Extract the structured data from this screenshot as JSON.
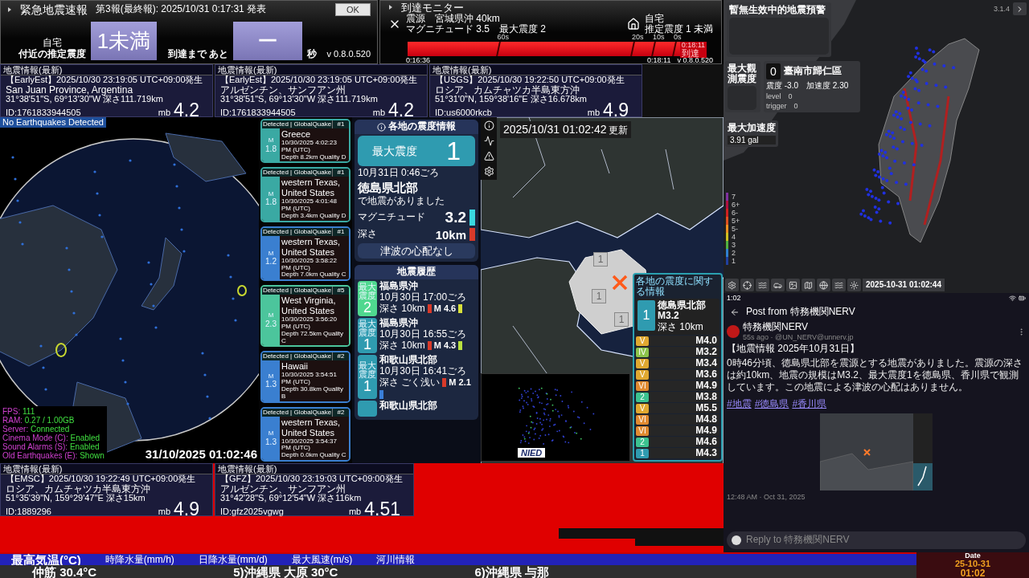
{
  "eew": {
    "title": "緊急地震速報",
    "report": "第3報(最終報): 2025/10/31 0:17:31 発表",
    "ok": "OK",
    "location_label": "自宅",
    "intensity_label": "付近の推定震度",
    "intensity": "1未満",
    "until_label": "到達まで あと",
    "seconds": "ー",
    "seconds_unit": "秒",
    "version": "v 0.8.0.520"
  },
  "arrival": {
    "title": "到達モニター",
    "epicenter": "震源　宮城県沖 40km",
    "magnitude": "マグニチュード 3.5　最大震度 2",
    "home": "自宅",
    "home_intensity": "推定震度 1 未満",
    "ticks": [
      "60s",
      "20s",
      "10s",
      "0s"
    ],
    "arrival_time": "0:18:11",
    "arrival_label": "到達",
    "start": "0:16:36",
    "end": "0:18:11",
    "version": "v 0.8.0.520"
  },
  "top_cards": [
    {
      "header": "地震情報(最新)",
      "source": "【EarlyEst】2025/10/30  23:19:05  UTC+09:00発生",
      "place": "San Juan Province, Argentina",
      "coords": "31°38'51\"S, 69°13'30\"W  深さ111.719km",
      "id": "ID:1761833944505",
      "mag_type": "mb",
      "mag": "4.2"
    },
    {
      "header": "地震情報(最新)",
      "source": "【EarlyEst】2025/10/30  23:19:05  UTC+09:00発生",
      "place": "アルゼンチン、サンフアン州",
      "coords": "31°38'51\"S, 69°13'30\"W  深さ111.719km",
      "id": "ID:1761833944505",
      "mag_type": "mb",
      "mag": "4.2"
    },
    {
      "header": "地震情報(最新)",
      "source": "【USGS】2025/10/30  19:22:50  UTC+09:00発生",
      "place": "ロシア、カムチャツカ半島東方沖",
      "coords": "51°31'0\"N, 159°38'16\"E  深さ16.678km",
      "id": "ID:us6000rkcb",
      "mag_type": "mb",
      "mag": "4.9"
    }
  ],
  "globe": {
    "banner": "No Earthquakes Detected",
    "stats": [
      {
        "label": "FPS:",
        "value": "111"
      },
      {
        "label": "RAM:",
        "value": "0.27 / 1.00GB"
      },
      {
        "label": "Server:",
        "value": "Connected"
      },
      {
        "label": "Cinema Mode (C):",
        "value": "Enabled"
      },
      {
        "label": "Sound Alarms (S):",
        "value": "Enabled"
      },
      {
        "label": "Old Earthquakes (E):",
        "value": "Shown"
      }
    ],
    "timestamp": "31/10/2025 01:02:46"
  },
  "detections": [
    {
      "source": "Detected | GlobalQuake",
      "number": "#1",
      "mag_label": "M",
      "mag": "1.8",
      "place": "Greece",
      "time": "10/30/2025 4:02:23 PM (UTC)",
      "depth": "Depth 8.2km",
      "quality": "Quality D",
      "color": "#3aa9a3"
    },
    {
      "source": "Detected | GlobalQuake",
      "number": "#1",
      "mag_label": "M",
      "mag": "1.8",
      "place": "western Texas, United States",
      "time": "10/30/2025 4:01:48 PM (UTC)",
      "depth": "Depth 3.4km",
      "quality": "Quality D",
      "color": "#3aa9a3"
    },
    {
      "source": "Detected | GlobalQuake",
      "number": "#1",
      "mag_label": "M",
      "mag": "1.2",
      "place": "western Texas, United States",
      "time": "10/30/2025 3:58:22 PM (UTC)",
      "depth": "Depth 7.0km",
      "quality": "Quality C",
      "color": "#3a7fd0"
    },
    {
      "source": "Detected | GlobalQuake",
      "number": "#5",
      "mag_label": "M",
      "mag": "2.3",
      "place": "West Virginia, United States",
      "time": "10/30/2025 3:56:20 PM (UTC)",
      "depth": "Depth 72.5km",
      "quality": "Quality C",
      "color": "#4cc59c"
    },
    {
      "source": "Detected | GlobalQuake",
      "number": "#2",
      "mag_label": "M",
      "mag": "1.3",
      "place": "Hawaii",
      "time": "10/30/2025 3:54:51 PM (UTC)",
      "depth": "Depth 30.8km",
      "quality": "Quality B",
      "color": "#3a7fd0"
    },
    {
      "source": "Detected | GlobalQuake",
      "number": "#2",
      "mag_label": "M",
      "mag": "1.3",
      "place": "western Texas, United States",
      "time": "10/30/2025 3:54:37 PM (UTC)",
      "depth": "Depth 0.0km",
      "quality": "Quality C",
      "color": "#3a7fd0"
    }
  ],
  "intensity_info": {
    "title": "各地の震度情報",
    "max_label": "最大震度",
    "max": "1",
    "time": "10月31日 0:46ごろ",
    "region": "徳島県北部",
    "note": "で地震がありました",
    "magnitude": {
      "label": "マグニチュード",
      "value": "3.2",
      "color": "#3ad8e0"
    },
    "depth": {
      "label": "深さ",
      "value": "10km",
      "color": "#d83a2a"
    },
    "tsunami": "津波の心配なし"
  },
  "history": {
    "title": "地震履歴",
    "items": [
      {
        "intensity_label": "最大震度",
        "intensity": "2",
        "color": "#4fd88f",
        "place": "福島県沖",
        "time": "10月30日 17:00ごろ",
        "depth": {
          "label": "深さ",
          "value": "10km",
          "color": "#d83a2a"
        },
        "magnitude": {
          "value": "M 4.6",
          "color": "#d8e03a"
        }
      },
      {
        "intensity_label": "最大震度",
        "intensity": "1",
        "color": "#2f9bb0",
        "place": "福島県沖",
        "time": "10月30日 16:55ごろ",
        "depth": {
          "label": "深さ",
          "value": "10km",
          "color": "#d83a2a"
        },
        "magnitude": {
          "value": "M 4.3",
          "color": "#b8e040"
        }
      },
      {
        "intensity_label": "最大震度",
        "intensity": "1",
        "color": "#2f9bb0",
        "place": "和歌山県北部",
        "time": "10月30日 16:41ごろ",
        "depth": {
          "label": "深さ",
          "value": "ごく浅い",
          "color": "#d83a2a"
        },
        "magnitude": {
          "value": "M 2.1",
          "color": "#3a7fd8"
        }
      },
      {
        "color": "#2f9bb0",
        "place": "和歌山県北部"
      }
    ]
  },
  "map": {
    "timestamp": "2025/10/31 01:02:42",
    "updated": "更新",
    "markers": [
      "1",
      "1",
      "1"
    ],
    "inset_logo": "NIED"
  },
  "map_list": {
    "title": "各地の震度に関する情報",
    "top": {
      "intensity": "1",
      "region": "徳島県北部",
      "mag": "M3.2",
      "depth_label": "深さ",
      "depth": "10km"
    },
    "items": [
      {
        "intensity": "V",
        "color": "#e0a830",
        "mag": "M4.0"
      },
      {
        "intensity": "IV",
        "color": "#8cc34a",
        "mag": "M3.2"
      },
      {
        "intensity": "V",
        "color": "#e0a830",
        "mag": "M3.4"
      },
      {
        "intensity": "V",
        "color": "#e0a830",
        "mag": "M3.6"
      },
      {
        "intensity": "VI",
        "color": "#e08a30",
        "mag": "M4.9"
      },
      {
        "intensity": "2",
        "color": "#3cc28f",
        "mag": "M3.8"
      },
      {
        "intensity": "V",
        "color": "#e0a830",
        "mag": "M5.5"
      },
      {
        "intensity": "VI",
        "color": "#e08a30",
        "mag": "M4.8"
      },
      {
        "intensity": "VI",
        "color": "#e08a30",
        "mag": "M4.9"
      },
      {
        "intensity": "2",
        "color": "#3cc28f",
        "mag": "M4.6"
      },
      {
        "intensity": "1",
        "color": "#2f9bb0",
        "mag": "M4.3"
      }
    ]
  },
  "bottom_cards": [
    {
      "header": "地震情報(最新)",
      "source": "【EMSC】2025/10/30  19:22:49  UTC+09:00発生",
      "place": "ロシア、カムチャツカ半島東方沖",
      "coords": "51°35'39\"N, 159°29'47\"E  深さ15km",
      "id": "ID:1889296",
      "mag_type": "mb",
      "mag": "4.9"
    },
    {
      "header": "地震情報(最新)",
      "source": "【GFZ】2025/10/30  23:19:03  UTC+09:00発生",
      "place": "アルゼンチン、サンフアン州",
      "coords": "31°42'28\"S, 69°12'54\"W  深さ116km",
      "id": "ID:gfz2025vgwg",
      "mag_type": "mb",
      "mag": "4.51"
    }
  ],
  "taiwan": {
    "version": "3.1.4",
    "warning_title": "暫無生效中的地震預警",
    "max_obs_label": "最大觀測震度",
    "station": {
      "intensity": "0",
      "name": "臺南市歸仁區",
      "detail": "震度 -3.0　加速度 2.30"
    },
    "level": "level　0",
    "trigger": "trigger　0",
    "max_acc_label": "最大加速度",
    "max_acc": "3.91 gal",
    "scale": [
      "7",
      "6+",
      "6-",
      "5+",
      "5-",
      "4",
      "3",
      "2",
      "1"
    ],
    "timestamp": "2025-10-31 01:02:44"
  },
  "nerv": {
    "status_time": "1:02",
    "header": "Post from 特務機関NERV",
    "author": "特務機関NERV",
    "handle": "55s ago · @UN_NERV@unnerv.jp",
    "heading": "【地震情報 2025年10月31日】",
    "body": "0時46分頃、徳島県北部を震源とする地震がありました。震源の深さは約10km、地震の規模はM3.2、最大震度1を徳島県、香川県で観測しています。この地震による津波の心配はありません。",
    "tags": [
      "#地震",
      "#徳島県",
      "#香川県"
    ],
    "posted": "12:48 AM · Oct 31, 2025",
    "reply_placeholder": "Reply to 特務機関NERV"
  },
  "ticker": {
    "headers": [
      "最高気温(°C)",
      "時降水量(mm/h)",
      "日降水量(mm/d)",
      "最大風速(m/s)",
      "河川情報"
    ],
    "items": [
      "仲筋 30.4°C",
      "5)沖縄県 大原 30°C",
      "6)沖縄県 与那"
    ],
    "date_label": "Date",
    "date": "25-10-31",
    "time": "01:02"
  }
}
